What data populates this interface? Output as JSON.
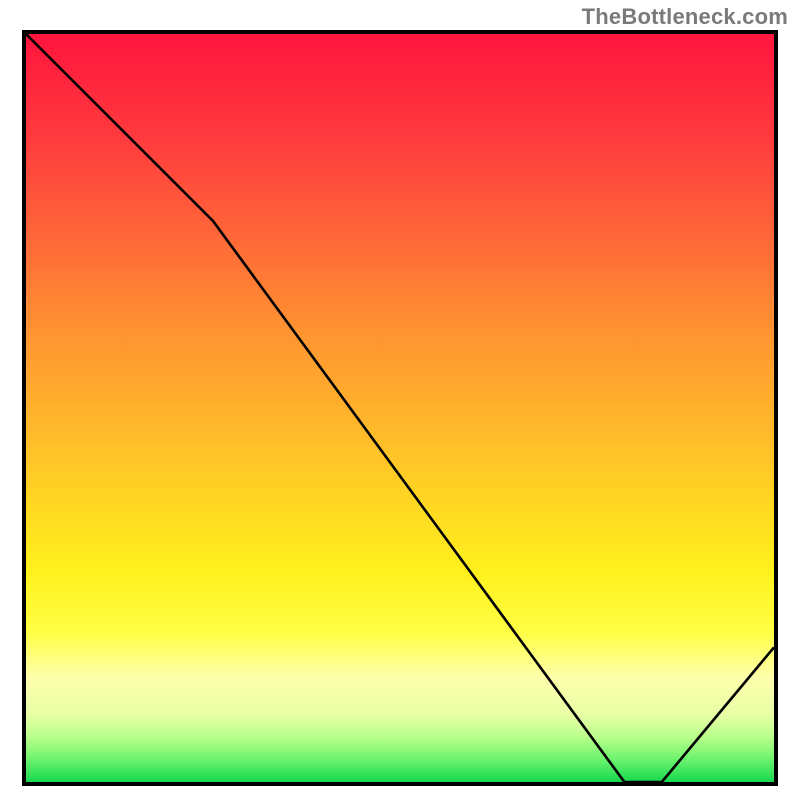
{
  "watermark": "TheBottleneck.com",
  "chart_data": {
    "type": "line",
    "x": [
      0,
      25,
      80,
      85,
      100
    ],
    "values": [
      100,
      75,
      0,
      0,
      18
    ],
    "xlim": [
      0,
      100
    ],
    "ylim": [
      0,
      100
    ],
    "title": "",
    "xlabel": "",
    "ylabel": "",
    "floor_label": {
      "text": "",
      "x": 78
    }
  },
  "colors": {
    "line": "#000000",
    "frame": "#000000",
    "watermark": "#7a7a7a",
    "floor_label": "#ff3a2c"
  }
}
